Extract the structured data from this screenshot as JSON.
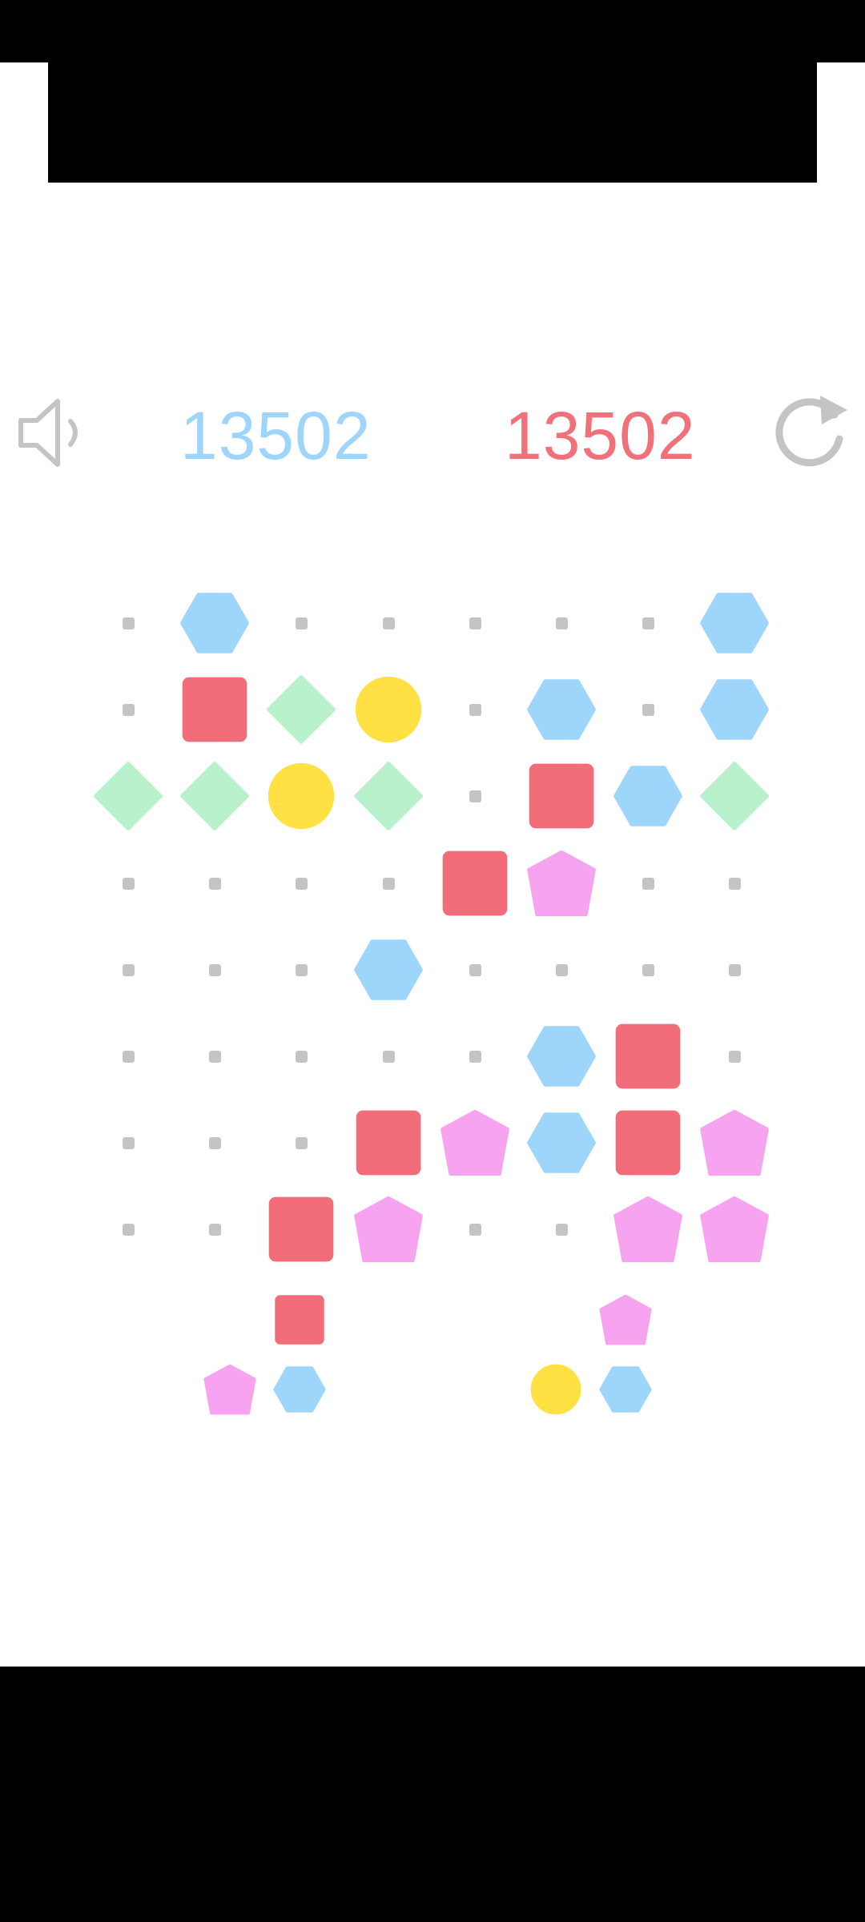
{
  "header": {
    "current_score": "13502",
    "best_score": "13502",
    "sound_icon": "speaker-icon",
    "restart_icon": "restart-icon"
  },
  "colors": {
    "square": "#f26d79",
    "hexagon": "#9ed5fb",
    "diamond": "#b8f1cc",
    "circle": "#ffe144",
    "pentagon": "#f6a4ef",
    "empty_dot": "#c4c4c4",
    "current_score": "#9fd5fb",
    "best_score": "#f07179"
  },
  "board": {
    "rows": 8,
    "cols": 8,
    "cells": [
      [
        ".",
        "hexagon",
        ".",
        ".",
        ".",
        ".",
        ".",
        "hexagon"
      ],
      [
        ".",
        "square",
        "diamond",
        "circle",
        ".",
        "hexagon",
        ".",
        "hexagon"
      ],
      [
        "diamond",
        "diamond",
        "circle",
        "diamond",
        ".",
        "square",
        "hexagon",
        "diamond"
      ],
      [
        ".",
        ".",
        ".",
        ".",
        "square",
        "pentagon",
        ".",
        "."
      ],
      [
        ".",
        ".",
        ".",
        "hexagon",
        ".",
        ".",
        ".",
        "."
      ],
      [
        ".",
        ".",
        ".",
        ".",
        ".",
        "hexagon",
        "square",
        "."
      ],
      [
        ".",
        ".",
        ".",
        "square",
        "pentagon",
        "hexagon",
        "square",
        "pentagon"
      ],
      [
        ".",
        ".",
        "square",
        "pentagon",
        ".",
        ".",
        "pentagon",
        "pentagon"
      ]
    ]
  },
  "next_pieces": [
    {
      "cells": [
        {
          "r": 0,
          "c": 1,
          "shape": "square"
        },
        {
          "r": 1,
          "c": 0,
          "shape": "pentagon"
        },
        {
          "r": 1,
          "c": 1,
          "shape": "hexagon"
        }
      ]
    },
    {
      "cells": [
        {
          "r": 0,
          "c": 1,
          "shape": "pentagon"
        },
        {
          "r": 1,
          "c": 0,
          "shape": "circle"
        },
        {
          "r": 1,
          "c": 1,
          "shape": "hexagon"
        }
      ]
    }
  ]
}
